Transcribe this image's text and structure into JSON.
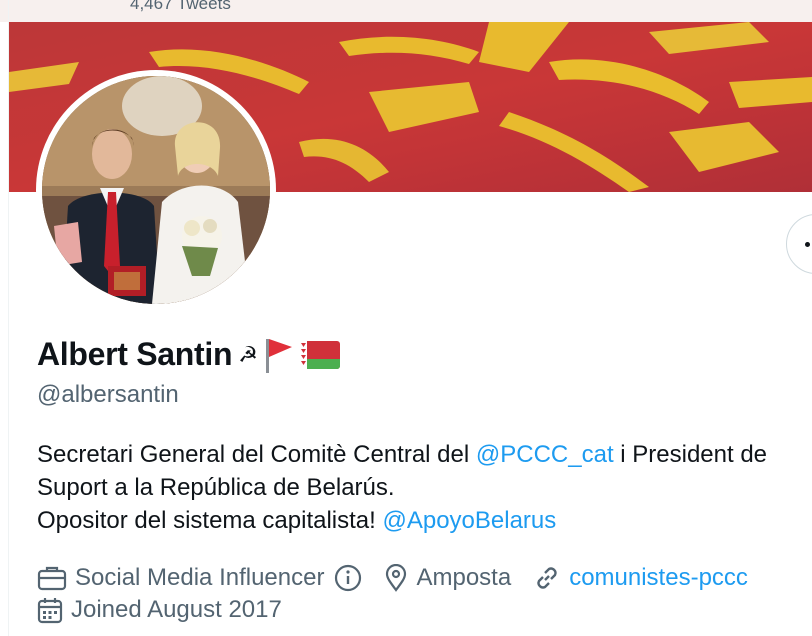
{
  "header": {
    "tweet_count": "4,467 Tweets"
  },
  "profile": {
    "display_name": "Albert Santin",
    "name_emoji": "☭",
    "handle": "@albersantin",
    "more_button_label": "More",
    "bio": {
      "line1_pre": "Secretari General del Comitè Central del ",
      "line1_mention": "@PCCC_cat",
      "line1_post": " i President de",
      "line2": "Suport a la República de Belarús.",
      "line3_pre": "Opositor del sistema capitalista! ",
      "line3_mention": "@ApoyoBelarus"
    },
    "meta": {
      "category": "Social Media Influencer",
      "location": "Amposta",
      "website": "comunistes-pccc",
      "joined": "Joined August 2017"
    }
  },
  "colors": {
    "accent": "#1d9bf0",
    "secondary_text": "#536471",
    "banner_red": "#c8323a",
    "banner_gold": "#f2c230"
  },
  "icons": [
    "hammer-sickle-icon",
    "red-flag-icon",
    "belarus-flag-icon",
    "briefcase-icon",
    "info-icon",
    "location-pin-icon",
    "link-icon",
    "calendar-icon",
    "more-dots-icon"
  ]
}
